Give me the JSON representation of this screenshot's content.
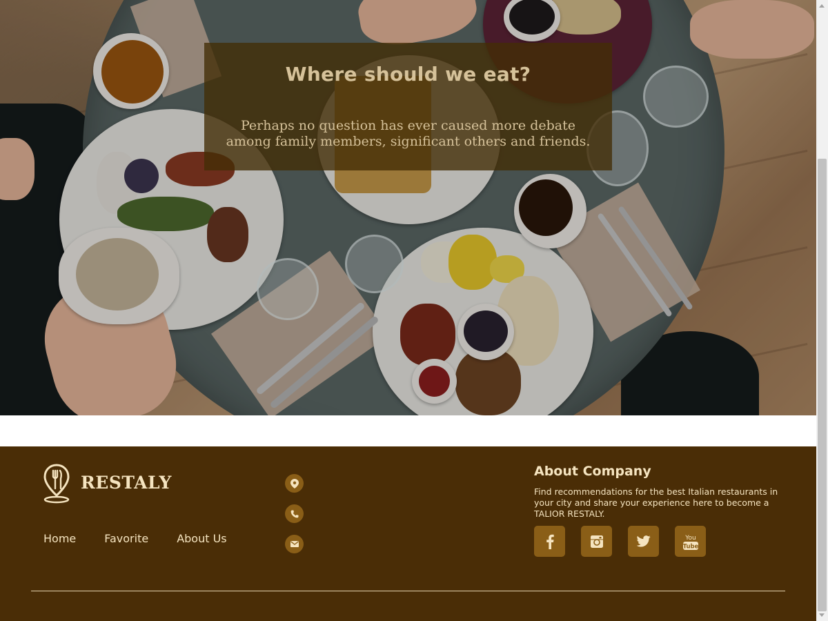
{
  "hero": {
    "title": "Where should we eat?",
    "text": "Perhaps no question has ever caused more debate among family members, significant others and friends."
  },
  "footer": {
    "brand": "RESTALY",
    "nav": [
      {
        "label": "Home"
      },
      {
        "label": "Favorite"
      },
      {
        "label": "About Us"
      }
    ],
    "contact_icons": [
      "location-icon",
      "phone-icon",
      "mail-icon"
    ],
    "about": {
      "title": "About Company",
      "text": "Find recommendations for the best Italian restaurants in your city and share your experience here to become a TALIOR RESTALY."
    },
    "social_icons": [
      "facebook-icon",
      "instagram-icon",
      "twitter-icon",
      "youtube-icon"
    ],
    "youtube_glyph_text": "You Tube"
  },
  "colors": {
    "footer_bg": "#4a2d06",
    "accent_button": "#8a5e17",
    "text_cream": "#f5e4c0",
    "hero_box": "#422d05"
  }
}
